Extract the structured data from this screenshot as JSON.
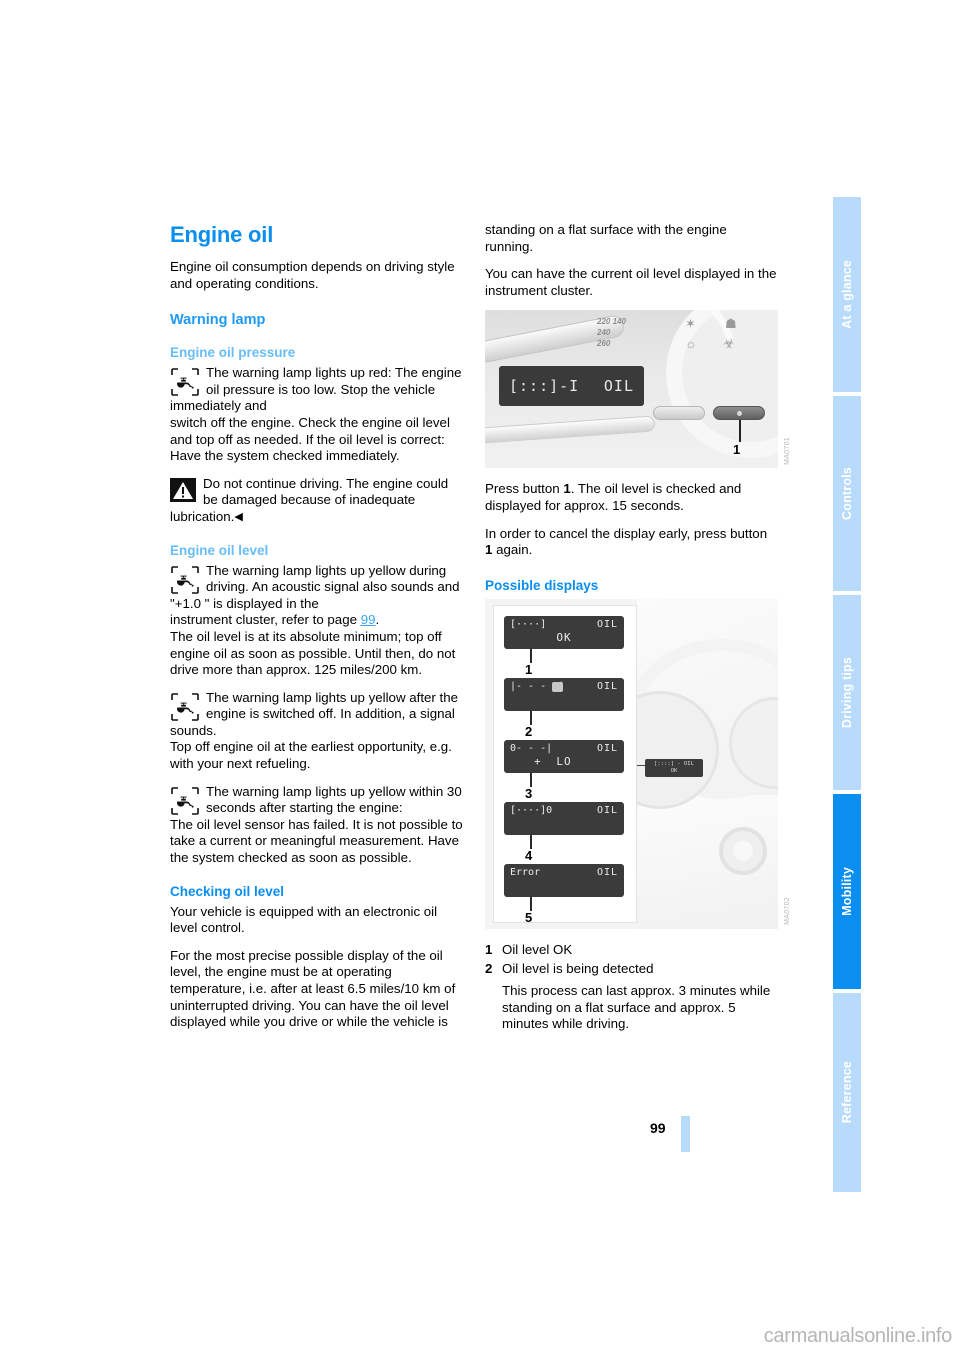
{
  "document": {
    "page_number": "99",
    "watermark": "carmanualsonline.info"
  },
  "tabs": [
    {
      "label": "At a glance",
      "active": false
    },
    {
      "label": "Controls",
      "active": false
    },
    {
      "label": "Driving tips",
      "active": false
    },
    {
      "label": "Mobility",
      "active": true
    },
    {
      "label": "Reference",
      "active": false
    }
  ],
  "left_column": {
    "title": "Engine oil",
    "intro": "Engine oil consumption depends on driving style and operating conditions.",
    "warning_lamp_heading": "Warning lamp",
    "oil_pressure": {
      "heading": "Engine oil pressure",
      "lamp_text": "The warning lamp lights up red: The engine oil pressure is too low. Stop the vehicle immediately and",
      "continuation": "switch off the engine. Check the engine oil level and top off as needed. If the oil level is correct: Have the system checked immediately.",
      "caution": "Do not continue driving. The engine could be damaged because of inadequate lubrication.",
      "caution_endmark": "◀"
    },
    "oil_level": {
      "heading": "Engine oil level",
      "case1_lamp": "The warning lamp lights up yellow during driving. An acoustic signal also sounds and \"+1.0 \" is displayed in the",
      "case1_cont_a": "instrument cluster, refer to page ",
      "case1_page_link": "99",
      "case1_cont_b": ".",
      "case1_cont_c": "The oil level is at its absolute minimum; top off engine oil as soon as possible. Until then, do not drive more than approx. 125 miles/200 km.",
      "case2_lamp": "The warning lamp lights up yellow after the engine is switched off. In addition, a signal sounds.",
      "case2_cont": "Top off engine oil at the earliest opportunity, e.g. with your next refueling.",
      "case3_lamp": "The warning lamp lights up yellow within 30 seconds after starting the engine:",
      "case3_cont": "The oil level sensor has failed. It is not possible to take a current or meaningful measurement. Have the system checked as soon as possible."
    },
    "checking": {
      "heading": "Checking oil level",
      "para1": "Your vehicle is equipped with an electronic oil level control.",
      "para2": "For the most precise possible display of the oil level, the engine must be at operating temperature, i.e. after at least 6.5 miles/10 km of uninterrupted driving. You can have the oil level displayed while you drive or while the vehicle is"
    }
  },
  "right_column": {
    "continuation_para": "standing on a flat surface with the engine running.",
    "para2": "You can have the current oil level displayed in the instrument cluster.",
    "figure_cluster": {
      "lcd_left": "[:::]-I",
      "lcd_right": "OIL",
      "scale_numbers": [
        "220",
        "140",
        "240",
        "260"
      ],
      "callout": "1",
      "code": "MA0701"
    },
    "press_button": {
      "before": "Press button ",
      "bold": "1",
      "after": ". The oil level is checked and displayed for approx. 15 seconds."
    },
    "cancel_display": {
      "before": "In order to cancel the display early, press button ",
      "bold": "1",
      "after": " again."
    },
    "possible_displays_heading": "Possible displays",
    "figure_displays": {
      "rows": [
        {
          "num": "1",
          "bar": "[····]",
          "right": "OIL",
          "mid": "OK"
        },
        {
          "num": "2",
          "bar": "|- - - -|",
          "right": "OIL",
          "mid": ""
        },
        {
          "num": "3",
          "bar": "0- - -|",
          "right": "OIL",
          "mid": "LO",
          "plus": "+"
        },
        {
          "num": "4",
          "bar": "[····]0",
          "right": "OIL",
          "mid": ""
        },
        {
          "num": "5",
          "bar": "Error",
          "right": "OIL",
          "mid": ""
        }
      ],
      "mini_lcd_line1": "[::::] -  OIL",
      "mini_lcd_line2": "OK",
      "code": "MA0702"
    },
    "list": [
      {
        "num": "1",
        "text": "Oil level OK"
      },
      {
        "num": "2",
        "text": "Oil level is being detected",
        "sub": "This process can last approx. 3 minutes while standing on a flat surface and approx. 5 minutes while driving."
      }
    ]
  },
  "colors": {
    "heading_blue": "#0a8ef0",
    "sub_blue": "#1e9bf5",
    "light_blue": "#67bdf7",
    "tab_inactive": "#b9dbfb",
    "tab_active": "#0a8ef0"
  }
}
